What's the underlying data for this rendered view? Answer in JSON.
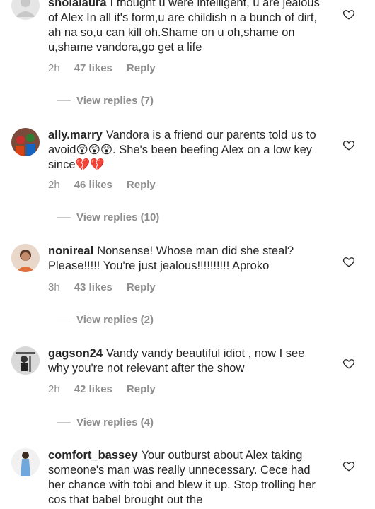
{
  "comments": [
    {
      "username": "sholalaura",
      "text": "I thought u were intelligent, u are jealous of Alex In all it's form,u are childish n a bunch of dirt, ah na so,u can kill oh.Shame on u oh,shame on u,shame vandora,go get a life",
      "time": "2h",
      "likes": "47 likes",
      "reply": "Reply",
      "view_replies": "View replies (7)"
    },
    {
      "username": "ally.marry",
      "text": "Vandora is a friend our parents told us to avoid😲😲😲. She's been beefing Alex on a low key since💔💔",
      "time": "2h",
      "likes": "46 likes",
      "reply": "Reply",
      "view_replies": "View replies (10)"
    },
    {
      "username": "nonireal",
      "text": "Nonsense!  Whose man did she steal? Please!!!!! You're just jealous!!!!!!!!!! Aproko",
      "time": "3h",
      "likes": "43 likes",
      "reply": "Reply",
      "view_replies": "View replies (2)"
    },
    {
      "username": "gagson24",
      "text": "Vandy vandy beautiful idiot , now I see why you're not relevant after the show",
      "time": "2h",
      "likes": "42 likes",
      "reply": "Reply",
      "view_replies": "View replies (4)"
    },
    {
      "username": "comfort_bassey",
      "text": "Your outburst about Alex taking someone's man was really unnecessary. Cece had her chance with tobi and blew it up. Stop trolling her cos that babel brought out the"
    }
  ],
  "icons": {
    "heart": "heart-outline-icon",
    "avatar_placeholder": "default-avatar-icon"
  },
  "colors": {
    "text": "#262626",
    "secondary": "#8e8e8e",
    "divider": "#c7c7c7"
  }
}
